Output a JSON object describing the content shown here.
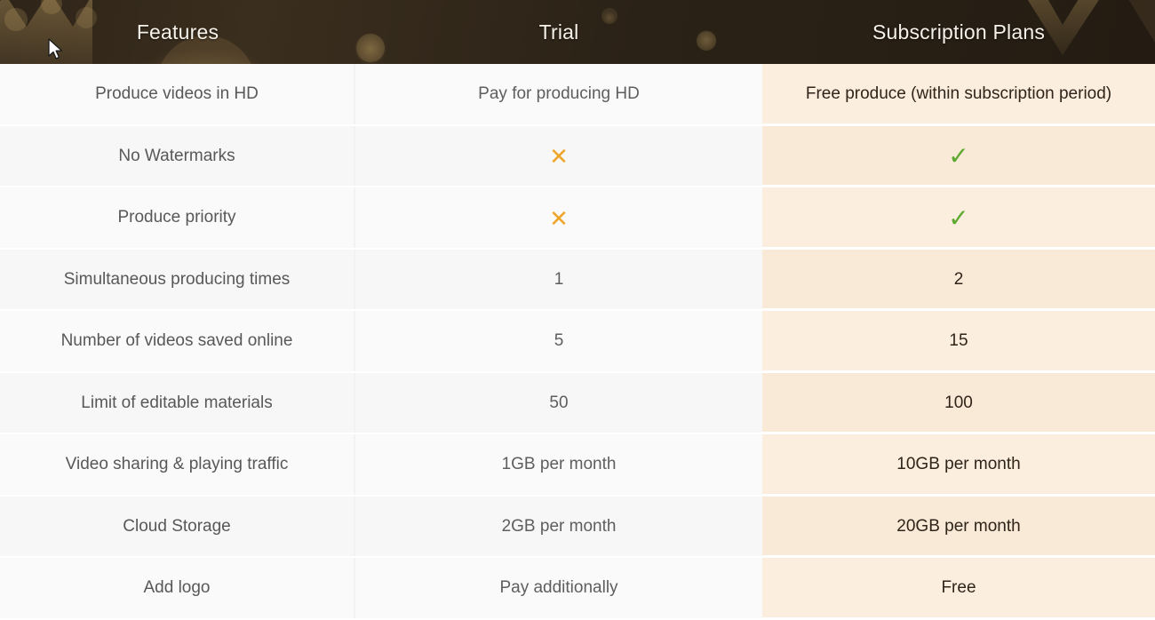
{
  "header": {
    "columns": [
      {
        "label": "Features"
      },
      {
        "label": "Trial"
      },
      {
        "label": "Subscription Plans"
      }
    ],
    "background_color": "#2e2418",
    "text_color": "#f6f2ea",
    "decoration": "crown-silhouette-and-bokeh-circles"
  },
  "colors": {
    "header_bg": "#2e2418",
    "plan_column_bg_odd": "#fbeedf",
    "plan_column_bg_even": "#f9e9d7",
    "light_column_bg_odd": "#fafafa",
    "light_column_bg_even": "#f7f7f7",
    "cross_color": "#eda62a",
    "check_color": "#5ba82d",
    "feature_text": "#585858",
    "trial_text": "#5e5e5e",
    "plan_text": "#2e2419"
  },
  "icons": {
    "cross": "✕",
    "check": "✓",
    "cursor": "arrow-cursor"
  },
  "table": {
    "columns": [
      "Features",
      "Trial",
      "Subscription Plans"
    ],
    "rows": [
      {
        "feature": "Produce videos in HD",
        "trial": {
          "type": "text",
          "value": "Pay for producing HD"
        },
        "plan": {
          "type": "text",
          "value": "Free produce (within subscription period)"
        }
      },
      {
        "feature": "No Watermarks",
        "trial": {
          "type": "cross",
          "value": "✕"
        },
        "plan": {
          "type": "check",
          "value": "✓"
        }
      },
      {
        "feature": "Produce priority",
        "trial": {
          "type": "cross",
          "value": "✕"
        },
        "plan": {
          "type": "check",
          "value": "✓"
        }
      },
      {
        "feature": "Simultaneous producing times",
        "trial": {
          "type": "text",
          "value": "1"
        },
        "plan": {
          "type": "text",
          "value": "2"
        }
      },
      {
        "feature": "Number of videos saved online",
        "trial": {
          "type": "text",
          "value": "5"
        },
        "plan": {
          "type": "text",
          "value": "15"
        }
      },
      {
        "feature": "Limit of editable materials",
        "trial": {
          "type": "text",
          "value": "50"
        },
        "plan": {
          "type": "text",
          "value": "100"
        }
      },
      {
        "feature": "Video sharing & playing traffic",
        "trial": {
          "type": "text",
          "value": "1GB per month"
        },
        "plan": {
          "type": "text",
          "value": "10GB per month"
        }
      },
      {
        "feature": "Cloud Storage",
        "trial": {
          "type": "text",
          "value": "2GB per month"
        },
        "plan": {
          "type": "text",
          "value": "20GB per month"
        }
      },
      {
        "feature": "Add logo",
        "trial": {
          "type": "text",
          "value": "Pay additionally"
        },
        "plan": {
          "type": "text",
          "value": "Free"
        }
      }
    ]
  }
}
